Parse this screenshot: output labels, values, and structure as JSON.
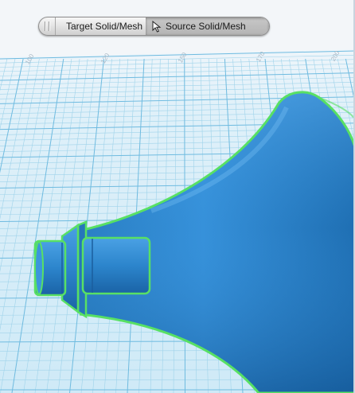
{
  "toolbar": {
    "target_label": "Target Solid/Mesh",
    "source_label": "Source Solid/Mesh",
    "active": "source"
  },
  "ruler": {
    "ticks": [
      "100",
      "120",
      "150",
      "170",
      "200"
    ]
  },
  "colors": {
    "grid_bg": "#e3f3fb",
    "grid_line": "#8dcbe7",
    "model": "#2f86cc",
    "selection_outline": "#58e064"
  }
}
